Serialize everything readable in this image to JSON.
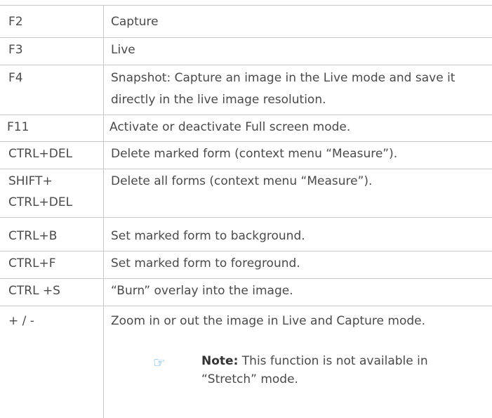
{
  "shortcuts": [
    {
      "key": "F2",
      "description": "Capture"
    },
    {
      "key": "F3",
      "description": "Live"
    },
    {
      "key": "F4",
      "description": "Snapshot: Capture an image in the Live mode and save it directly in the live image resolution."
    },
    {
      "key": "F11",
      "description": "Activate or deactivate Full screen mode."
    },
    {
      "key": "CTRL+DEL",
      "description": "Delete marked form (context menu “Measure”)."
    },
    {
      "key": "SHIFT+\nCTRL+DEL",
      "description": "Delete all forms (context menu “Measure”)."
    },
    {
      "key": "CTRL+B",
      "description": "Set marked form to background."
    },
    {
      "key": "CTRL+F",
      "description": "Set marked form to foreground."
    },
    {
      "key": "CTRL +S",
      "description": "“Burn” overlay into the image."
    },
    {
      "key": "+ / -",
      "description": "Zoom in or out the image in Live and Capture mode."
    }
  ],
  "note": {
    "icon": "pointing-hand-icon",
    "label": "Note:",
    "text": " This function is not available in “Stretch” mode."
  },
  "colors": {
    "text": "#4a4a4a",
    "rule": "#c8c8c8",
    "note_icon": "#4a9fd8"
  }
}
